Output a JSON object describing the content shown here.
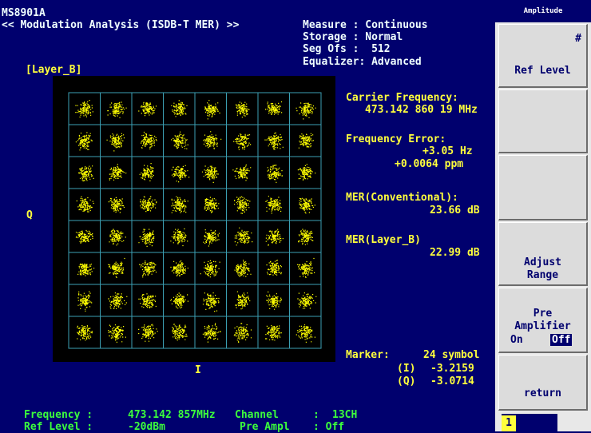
{
  "header": {
    "model": "MS8901A",
    "title": "<< Modulation Analysis (ISDB-T MER) >>",
    "measure": "Measure : Continuous",
    "storage": "Storage : Normal",
    "seg_ofs": "Seg Ofs :  512",
    "equalizer": "Equalizer: Advanced",
    "layer": "[Layer_B]"
  },
  "axes": {
    "q_label": "Q",
    "i_label": "I"
  },
  "results": {
    "carrier_frequency_label": "Carrier Frequency:",
    "carrier_frequency_value": "473.142 860 19 MHz",
    "frequency_error_label": "Frequency Error:",
    "frequency_error_hz": "+3.05 Hz",
    "frequency_error_ppm": "+0.0064 ppm",
    "mer_conventional_label": "MER(Conventional):",
    "mer_conventional_value": "23.66 dB",
    "mer_layer_label": "MER(Layer_B)",
    "mer_layer_value": "22.99 dB"
  },
  "marker": {
    "label": "Marker:",
    "symbol": "24 symbol",
    "i_label": "(I)",
    "i_value": "-3.2159",
    "q_label": "(Q)",
    "q_value": "-3.0714"
  },
  "footer": {
    "frequency_label": "Frequency :",
    "frequency_value": "473.142 857MHz",
    "channel_label": "Channel",
    "channel_sep": ":",
    "channel_value": "13CH",
    "ref_level_label": "Ref Level :",
    "ref_level_value": "-20dBm",
    "pre_ampl_label": "Pre Ampl",
    "pre_ampl_value": ": Off"
  },
  "softkeys": {
    "panel_title": "Amplitude",
    "ref_level_marker": "#",
    "ref_level": "Ref Level",
    "adjust_range_1": "Adjust",
    "adjust_range_2": "Range",
    "pre_amp_1": "Pre",
    "pre_amp_2": "Amplifier",
    "pre_amp_on": "On",
    "pre_amp_off": "Off",
    "return": "return",
    "page_number": "1"
  },
  "colors": {
    "background": "#00006e",
    "text_yellow": "#ffff3c",
    "text_cyan": "#f0ffff",
    "text_green": "#3cff3c",
    "grid": "#3ca0b4",
    "points": "#ffff00"
  },
  "constellation": {
    "modulation_grid": "64QAM",
    "columns": 8,
    "rows": 8
  }
}
